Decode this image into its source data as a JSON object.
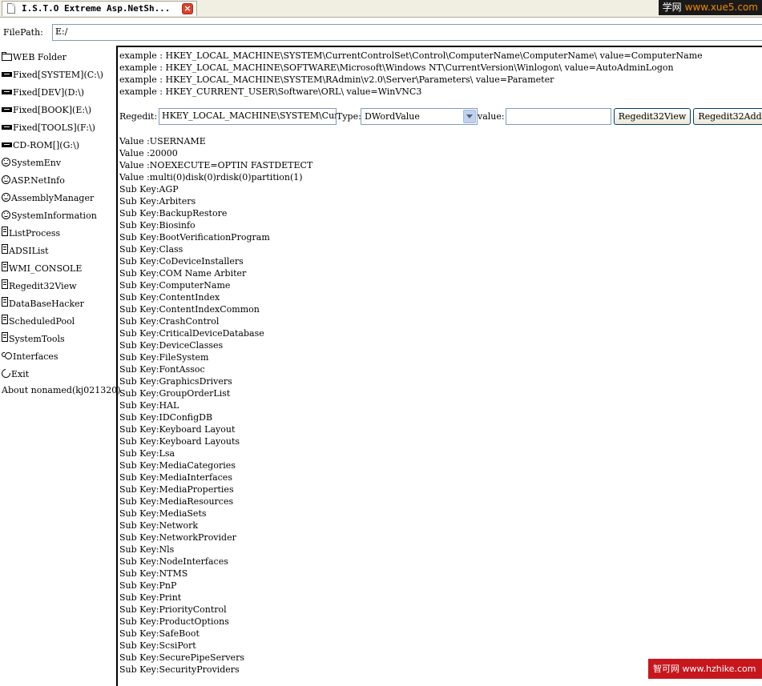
{
  "tab": {
    "title": "I.S.T.O Extreme Asp.NetSh...",
    "close_label": "×"
  },
  "watermark_top": {
    "site": "学网",
    "url": "www.xue5.com"
  },
  "path": {
    "label": "FilePath:",
    "value": "E:/"
  },
  "sidebar": {
    "items": [
      {
        "label": "WEB Folder",
        "icon": "folder-icon"
      },
      {
        "label": "Fixed[SYSTEM](C:\\)",
        "icon": "drive-icon"
      },
      {
        "label": "Fixed[DEV](D:\\)",
        "icon": "drive-icon"
      },
      {
        "label": "Fixed[BOOK](E:\\)",
        "icon": "drive-icon"
      },
      {
        "label": "Fixed[TOOLS](F:\\)",
        "icon": "drive-icon"
      },
      {
        "label": "CD-ROM[](G:\\)",
        "icon": "drive-icon"
      },
      {
        "label": "SystemEnv",
        "icon": "smiley-icon"
      },
      {
        "label": "ASP.NetInfo",
        "icon": "smiley-icon"
      },
      {
        "label": "AssemblyManager",
        "icon": "smiley-icon"
      },
      {
        "label": "SystemInformation",
        "icon": "smiley-icon"
      },
      {
        "label": "ListProcess",
        "icon": "document-icon"
      },
      {
        "label": "ADSIList",
        "icon": "document-icon"
      },
      {
        "label": "WMI_CONSOLE",
        "icon": "document-icon"
      },
      {
        "label": "Regedit32View",
        "icon": "document-icon"
      },
      {
        "label": "DataBaseHacker",
        "icon": "document-icon"
      },
      {
        "label": "ScheduledPool",
        "icon": "document-icon"
      },
      {
        "label": "SystemTools",
        "icon": "document-icon"
      },
      {
        "label": "Interfaces",
        "icon": "interfaces-icon"
      },
      {
        "label": "Exit",
        "icon": "exit-icon"
      }
    ],
    "about": "About nonamed(kj021320)"
  },
  "examples": [
    "example : HKEY_LOCAL_MACHINE\\SYSTEM\\CurrentControlSet\\Control\\ComputerName\\ComputerName\\ value=ComputerName",
    "example : HKEY_LOCAL_MACHINE\\SOFTWARE\\Microsoft\\Windows NT\\CurrentVersion\\Winlogon\\ value=AutoAdminLogon",
    "example : HKEY_LOCAL_MACHINE\\SYSTEM\\RAdmin\\v2.0\\Server\\Parameters\\ value=Parameter",
    "example : HKEY_CURRENT_USER\\Software\\ORL\\ value=WinVNC3"
  ],
  "regedit": {
    "label": "Regedit:",
    "key_value": "HKEY_LOCAL_MACHINE\\SYSTEM\\CurrentCon",
    "type_label": "Type:",
    "type_selected": "DWordValue",
    "value_label": "value:",
    "value_value": "",
    "view_button": "Regedit32View",
    "add_button": "Regedit32Add"
  },
  "results": [
    "Value :USERNAME",
    "Value :20000",
    "Value :NOEXECUTE=OPTIN FASTDETECT",
    "Value :multi(0)disk(0)rdisk(0)partition(1)",
    "Sub Key:AGP",
    "Sub Key:Arbiters",
    "Sub Key:BackupRestore",
    "Sub Key:Biosinfo",
    "Sub Key:BootVerificationProgram",
    "Sub Key:Class",
    "Sub Key:CoDeviceInstallers",
    "Sub Key:COM Name Arbiter",
    "Sub Key:ComputerName",
    "Sub Key:ContentIndex",
    "Sub Key:ContentIndexCommon",
    "Sub Key:CrashControl",
    "Sub Key:CriticalDeviceDatabase",
    "Sub Key:DeviceClasses",
    "Sub Key:FileSystem",
    "Sub Key:FontAssoc",
    "Sub Key:GraphicsDrivers",
    "Sub Key:GroupOrderList",
    "Sub Key:HAL",
    "Sub Key:IDConfigDB",
    "Sub Key:Keyboard Layout",
    "Sub Key:Keyboard Layouts",
    "Sub Key:Lsa",
    "Sub Key:MediaCategories",
    "Sub Key:MediaInterfaces",
    "Sub Key:MediaProperties",
    "Sub Key:MediaResources",
    "Sub Key:MediaSets",
    "Sub Key:Network",
    "Sub Key:NetworkProvider",
    "Sub Key:Nls",
    "Sub Key:NodeInterfaces",
    "Sub Key:NTMS",
    "Sub Key:PnP",
    "Sub Key:Print",
    "Sub Key:PriorityControl",
    "Sub Key:ProductOptions",
    "Sub Key:SafeBoot",
    "Sub Key:ScsiPort",
    "Sub Key:SecurePipeServers",
    "Sub Key:SecurityProviders"
  ],
  "watermark_bottom": "智可网 www.hzhike.com"
}
